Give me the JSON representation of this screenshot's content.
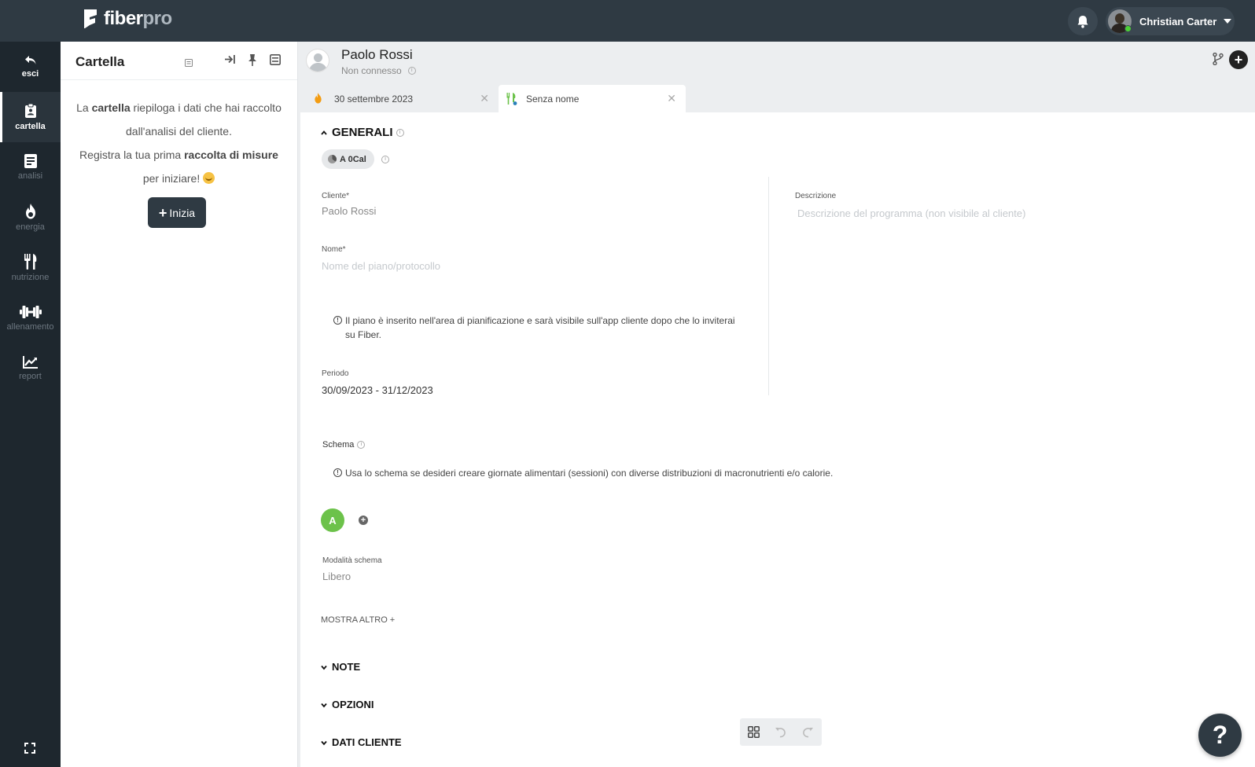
{
  "app": {
    "logo_main": "fiber",
    "logo_accent": "pro",
    "user_name": "Christian Carter"
  },
  "nav": {
    "items": [
      {
        "label": "esci",
        "icon": "undo-arrow-icon"
      },
      {
        "label": "cartella",
        "icon": "clipboard-icon"
      },
      {
        "label": "analisi",
        "icon": "document-icon"
      },
      {
        "label": "energia",
        "icon": "flame-icon"
      },
      {
        "label": "nutrizione",
        "icon": "fork-knife-icon"
      },
      {
        "label": "allenamento",
        "icon": "dumbbell-icon"
      },
      {
        "label": "report",
        "icon": "chart-line-icon"
      }
    ]
  },
  "panel": {
    "title": "Cartella",
    "line1_a": "La ",
    "line1_b": "cartella",
    "line1_c": " riepiloga i dati che hai raccolto dall'analisi del cliente.",
    "line2_a": "Registra la tua prima ",
    "line2_b": "raccolta di misure",
    "line2_c": " per iniziare! ",
    "start_label": "Inizia"
  },
  "client": {
    "name": "Paolo Rossi",
    "status": "Non connesso"
  },
  "tabs": [
    {
      "label": "30 settembre 2023"
    },
    {
      "label": "Senza nome"
    }
  ],
  "generali": {
    "title": "GENERALI",
    "chip": "A 0Cal",
    "cliente_label": "Cliente*",
    "cliente_value": "Paolo Rossi",
    "nome_label": "Nome*",
    "nome_placeholder": "Nome del piano/protocollo",
    "notice": "Il piano è inserito nell'area di pianificazione e sarà visibile sull'app cliente dopo che lo inviterai su Fiber.",
    "periodo_label": "Periodo",
    "periodo_value": "30/09/2023 - 31/12/2023",
    "descrizione_label": "Descrizione",
    "descrizione_placeholder": "Descrizione del programma (non visibile al cliente)",
    "schema_label": "Schema",
    "schema_notice": "Usa lo schema se desideri creare giornate alimentari (sessioni) con diverse distribuzioni di macronutrienti e/o calorie.",
    "session_label": "A",
    "modalita_label": "Modalità schema",
    "modalita_value": "Libero",
    "mostra_altro": "MOSTRA ALTRO +"
  },
  "sections": {
    "note": "NOTE",
    "opzioni": "OPZIONI",
    "dati_cliente": "DATI CLIENTE"
  },
  "help": {
    "label": "?"
  },
  "colors": {
    "topbar": "#2f3a43",
    "sidebar": "#1e272e",
    "session_green": "#6cc24a",
    "online_green": "#4cd137"
  }
}
